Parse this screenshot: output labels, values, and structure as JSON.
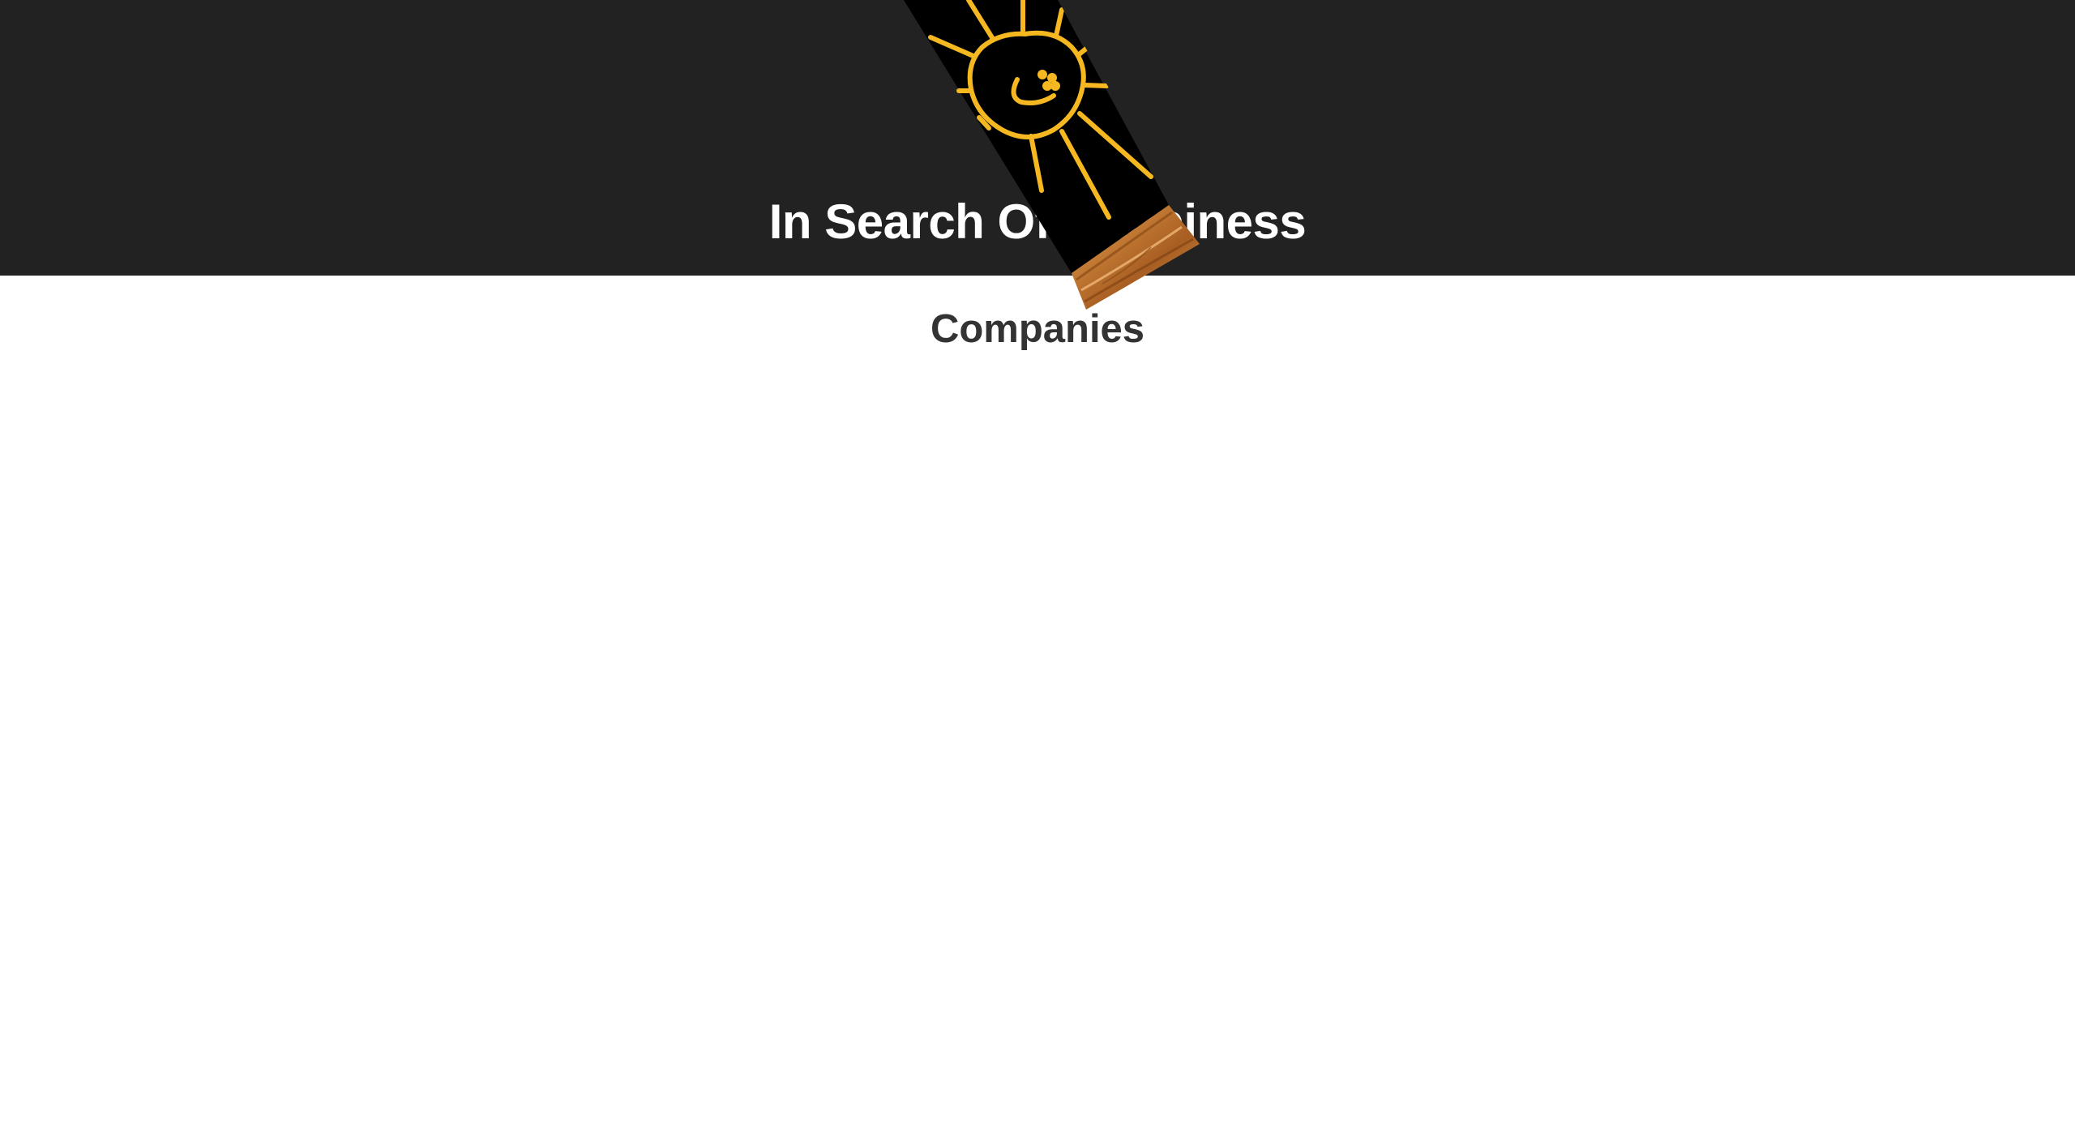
{
  "header": {
    "title": "In Search Of Happiness"
  },
  "main": {
    "heading": "Companies"
  },
  "banner": {
    "icon": "smiling-sun-icon",
    "background_color": "#000000",
    "sun_color": "#F5B820",
    "wood_color": "#C27A34"
  },
  "colors": {
    "header_bg": "#222222",
    "header_text": "#ffffff",
    "heading_text": "#333333",
    "page_bg": "#ffffff"
  }
}
